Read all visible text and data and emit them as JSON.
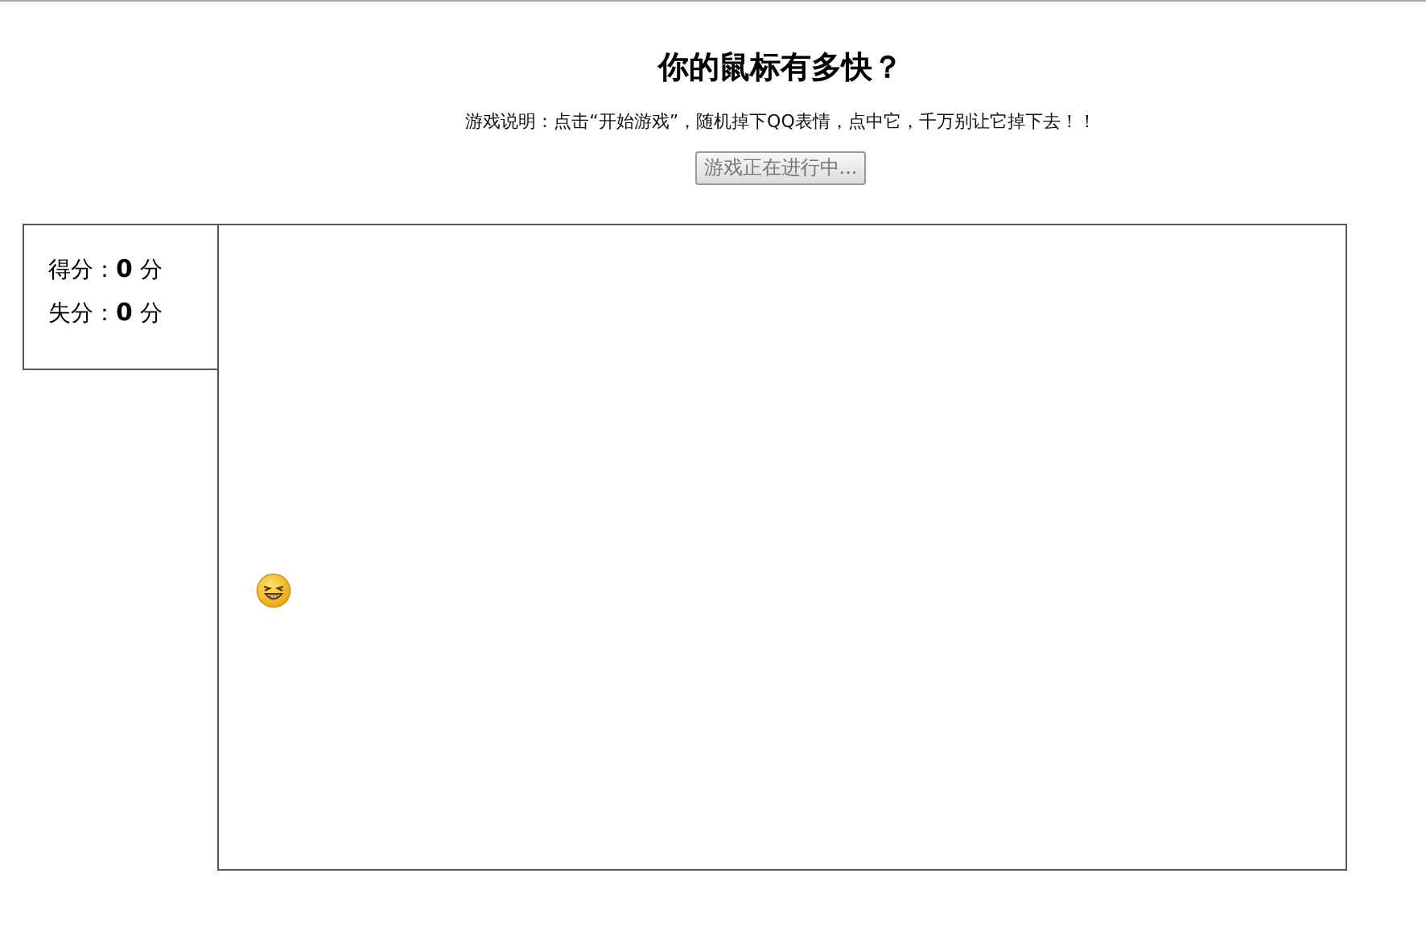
{
  "title": "你的鼠标有多快？",
  "instructions": "游戏说明：点击“开始游戏”，随机掉下QQ表情，点中它，千万别让它掉下去！！",
  "start_button": {
    "label": "游戏正在进行中...",
    "disabled": true
  },
  "scores": [
    {
      "label": "得分：",
      "value": "0",
      "unit": "分"
    },
    {
      "label": "失分：",
      "value": "0",
      "unit": "分"
    }
  ]
}
